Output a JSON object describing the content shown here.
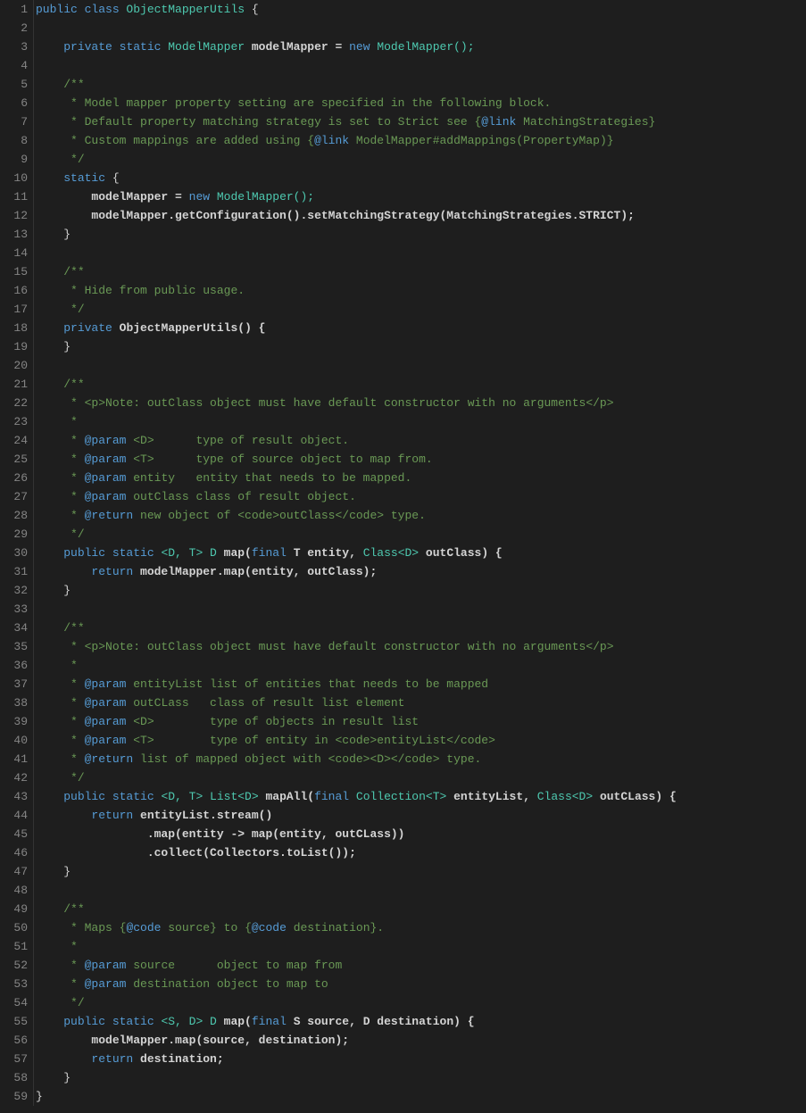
{
  "totalLines": 59,
  "tokens": [
    [
      [
        "public ",
        "kw"
      ],
      [
        "class ",
        "kw"
      ],
      [
        "ObjectMapperUtils ",
        "cls"
      ],
      [
        "{",
        "punc"
      ]
    ],
    [],
    [
      [
        "    ",
        ""
      ],
      [
        "private ",
        "kw"
      ],
      [
        "static ",
        "kw"
      ],
      [
        "ModelMapper ",
        "cls"
      ],
      [
        "modelMapper = ",
        "ident"
      ],
      [
        "new ",
        "kw"
      ],
      [
        "ModelMapper();",
        "cls"
      ]
    ],
    [],
    [
      [
        "    ",
        ""
      ],
      [
        "/**",
        "comment"
      ]
    ],
    [
      [
        "    ",
        ""
      ],
      [
        " * Model mapper property setting are specified in the following block.",
        "comment"
      ]
    ],
    [
      [
        "    ",
        ""
      ],
      [
        " * Default property matching strategy is set to Strict see {",
        "comment"
      ],
      [
        "@link",
        "docparam"
      ],
      [
        " MatchingStrategies}",
        "comment"
      ]
    ],
    [
      [
        "    ",
        ""
      ],
      [
        " * Custom mappings are added using {",
        "comment"
      ],
      [
        "@link",
        "docparam"
      ],
      [
        " ModelMapper#addMappings(PropertyMap)}",
        "comment"
      ]
    ],
    [
      [
        "    ",
        ""
      ],
      [
        " */",
        "comment"
      ]
    ],
    [
      [
        "    ",
        ""
      ],
      [
        "static ",
        "kw"
      ],
      [
        "{",
        "punc"
      ]
    ],
    [
      [
        "        ",
        ""
      ],
      [
        "modelMapper = ",
        "ident"
      ],
      [
        "new ",
        "kw"
      ],
      [
        "ModelMapper();",
        "cls"
      ]
    ],
    [
      [
        "        ",
        ""
      ],
      [
        "modelMapper.getConfiguration().setMatchingStrategy(MatchingStrategies.STRICT);",
        "ident"
      ]
    ],
    [
      [
        "    ",
        ""
      ],
      [
        "}",
        "punc"
      ]
    ],
    [],
    [
      [
        "    ",
        ""
      ],
      [
        "/**",
        "comment"
      ]
    ],
    [
      [
        "    ",
        ""
      ],
      [
        " * Hide from public usage.",
        "comment"
      ]
    ],
    [
      [
        "    ",
        ""
      ],
      [
        " */",
        "comment"
      ]
    ],
    [
      [
        "    ",
        ""
      ],
      [
        "private ",
        "kw"
      ],
      [
        "ObjectMapperUtils() {",
        "ident"
      ]
    ],
    [
      [
        "    ",
        ""
      ],
      [
        "}",
        "punc"
      ]
    ],
    [],
    [
      [
        "    ",
        ""
      ],
      [
        "/**",
        "comment"
      ]
    ],
    [
      [
        "    ",
        ""
      ],
      [
        " * <p>Note: outClass object must have default constructor with no arguments</p>",
        "comment"
      ]
    ],
    [
      [
        "    ",
        ""
      ],
      [
        " *",
        "comment"
      ]
    ],
    [
      [
        "    ",
        ""
      ],
      [
        " * ",
        "comment"
      ],
      [
        "@param",
        "docparam"
      ],
      [
        " <D>      type of result object.",
        "comment"
      ]
    ],
    [
      [
        "    ",
        ""
      ],
      [
        " * ",
        "comment"
      ],
      [
        "@param",
        "docparam"
      ],
      [
        " <T>      type of source object to map from.",
        "comment"
      ]
    ],
    [
      [
        "    ",
        ""
      ],
      [
        " * ",
        "comment"
      ],
      [
        "@param",
        "docparam"
      ],
      [
        " entity   entity that needs to be mapped.",
        "comment"
      ]
    ],
    [
      [
        "    ",
        ""
      ],
      [
        " * ",
        "comment"
      ],
      [
        "@param",
        "docparam"
      ],
      [
        " outClass class of result object.",
        "comment"
      ]
    ],
    [
      [
        "    ",
        ""
      ],
      [
        " * ",
        "comment"
      ],
      [
        "@return",
        "docparam"
      ],
      [
        " new object of <code>outClass</code> type.",
        "comment"
      ]
    ],
    [
      [
        "    ",
        ""
      ],
      [
        " */",
        "comment"
      ]
    ],
    [
      [
        "    ",
        ""
      ],
      [
        "public ",
        "kw"
      ],
      [
        "static ",
        "kw"
      ],
      [
        "<D, T> D ",
        "cls"
      ],
      [
        "map(",
        "method"
      ],
      [
        "final ",
        "kw"
      ],
      [
        "T entity, ",
        "ident"
      ],
      [
        "Class<D> ",
        "cls"
      ],
      [
        "outClass) {",
        "ident"
      ]
    ],
    [
      [
        "        ",
        ""
      ],
      [
        "return ",
        "kw"
      ],
      [
        "modelMapper.map(entity, outClass);",
        "ident"
      ]
    ],
    [
      [
        "    ",
        ""
      ],
      [
        "}",
        "punc"
      ]
    ],
    [],
    [
      [
        "    ",
        ""
      ],
      [
        "/**",
        "comment"
      ]
    ],
    [
      [
        "    ",
        ""
      ],
      [
        " * <p>Note: outClass object must have default constructor with no arguments</p>",
        "comment"
      ]
    ],
    [
      [
        "    ",
        ""
      ],
      [
        " *",
        "comment"
      ]
    ],
    [
      [
        "    ",
        ""
      ],
      [
        " * ",
        "comment"
      ],
      [
        "@param",
        "docparam"
      ],
      [
        " entityList list of entities that needs to be mapped",
        "comment"
      ]
    ],
    [
      [
        "    ",
        ""
      ],
      [
        " * ",
        "comment"
      ],
      [
        "@param",
        "docparam"
      ],
      [
        " outCLass   class of result list element",
        "comment"
      ]
    ],
    [
      [
        "    ",
        ""
      ],
      [
        " * ",
        "comment"
      ],
      [
        "@param",
        "docparam"
      ],
      [
        " <D>        type of objects in result list",
        "comment"
      ]
    ],
    [
      [
        "    ",
        ""
      ],
      [
        " * ",
        "comment"
      ],
      [
        "@param",
        "docparam"
      ],
      [
        " <T>        type of entity in <code>entityList</code>",
        "comment"
      ]
    ],
    [
      [
        "    ",
        ""
      ],
      [
        " * ",
        "comment"
      ],
      [
        "@return",
        "docparam"
      ],
      [
        " list of mapped object with <code><D></code> type.",
        "comment"
      ]
    ],
    [
      [
        "    ",
        ""
      ],
      [
        " */",
        "comment"
      ]
    ],
    [
      [
        "    ",
        ""
      ],
      [
        "public ",
        "kw"
      ],
      [
        "static ",
        "kw"
      ],
      [
        "<D, T> List<D> ",
        "cls"
      ],
      [
        "mapAll(",
        "method"
      ],
      [
        "final ",
        "kw"
      ],
      [
        "Collection<T> ",
        "cls"
      ],
      [
        "entityList, ",
        "ident"
      ],
      [
        "Class<D> ",
        "cls"
      ],
      [
        "outCLass) {",
        "ident"
      ]
    ],
    [
      [
        "        ",
        ""
      ],
      [
        "return ",
        "kw"
      ],
      [
        "entityList.stream()",
        "ident"
      ]
    ],
    [
      [
        "                ",
        ""
      ],
      [
        ".map(entity -> map(entity, outCLass))",
        "ident"
      ]
    ],
    [
      [
        "                ",
        ""
      ],
      [
        ".collect(Collectors.toList());",
        "ident"
      ]
    ],
    [
      [
        "    ",
        ""
      ],
      [
        "}",
        "punc"
      ]
    ],
    [],
    [
      [
        "    ",
        ""
      ],
      [
        "/**",
        "comment"
      ]
    ],
    [
      [
        "    ",
        ""
      ],
      [
        " * Maps {",
        "comment"
      ],
      [
        "@code",
        "docparam"
      ],
      [
        " source} to {",
        "comment"
      ],
      [
        "@code",
        "docparam"
      ],
      [
        " destination}.",
        "comment"
      ]
    ],
    [
      [
        "    ",
        ""
      ],
      [
        " *",
        "comment"
      ]
    ],
    [
      [
        "    ",
        ""
      ],
      [
        " * ",
        "comment"
      ],
      [
        "@param",
        "docparam"
      ],
      [
        " source      object to map from",
        "comment"
      ]
    ],
    [
      [
        "    ",
        ""
      ],
      [
        " * ",
        "comment"
      ],
      [
        "@param",
        "docparam"
      ],
      [
        " destination object to map to",
        "comment"
      ]
    ],
    [
      [
        "    ",
        ""
      ],
      [
        " */",
        "comment"
      ]
    ],
    [
      [
        "    ",
        ""
      ],
      [
        "public ",
        "kw"
      ],
      [
        "static ",
        "kw"
      ],
      [
        "<S, D> D ",
        "cls"
      ],
      [
        "map(",
        "method"
      ],
      [
        "final ",
        "kw"
      ],
      [
        "S source, ",
        "ident"
      ],
      [
        "D destination) {",
        "ident"
      ]
    ],
    [
      [
        "        ",
        ""
      ],
      [
        "modelMapper.map(source, destination);",
        "ident"
      ]
    ],
    [
      [
        "        ",
        ""
      ],
      [
        "return ",
        "kw"
      ],
      [
        "destination;",
        "ident"
      ]
    ],
    [
      [
        "    ",
        ""
      ],
      [
        "}",
        "punc"
      ]
    ],
    [
      [
        "}",
        "punc"
      ]
    ]
  ]
}
